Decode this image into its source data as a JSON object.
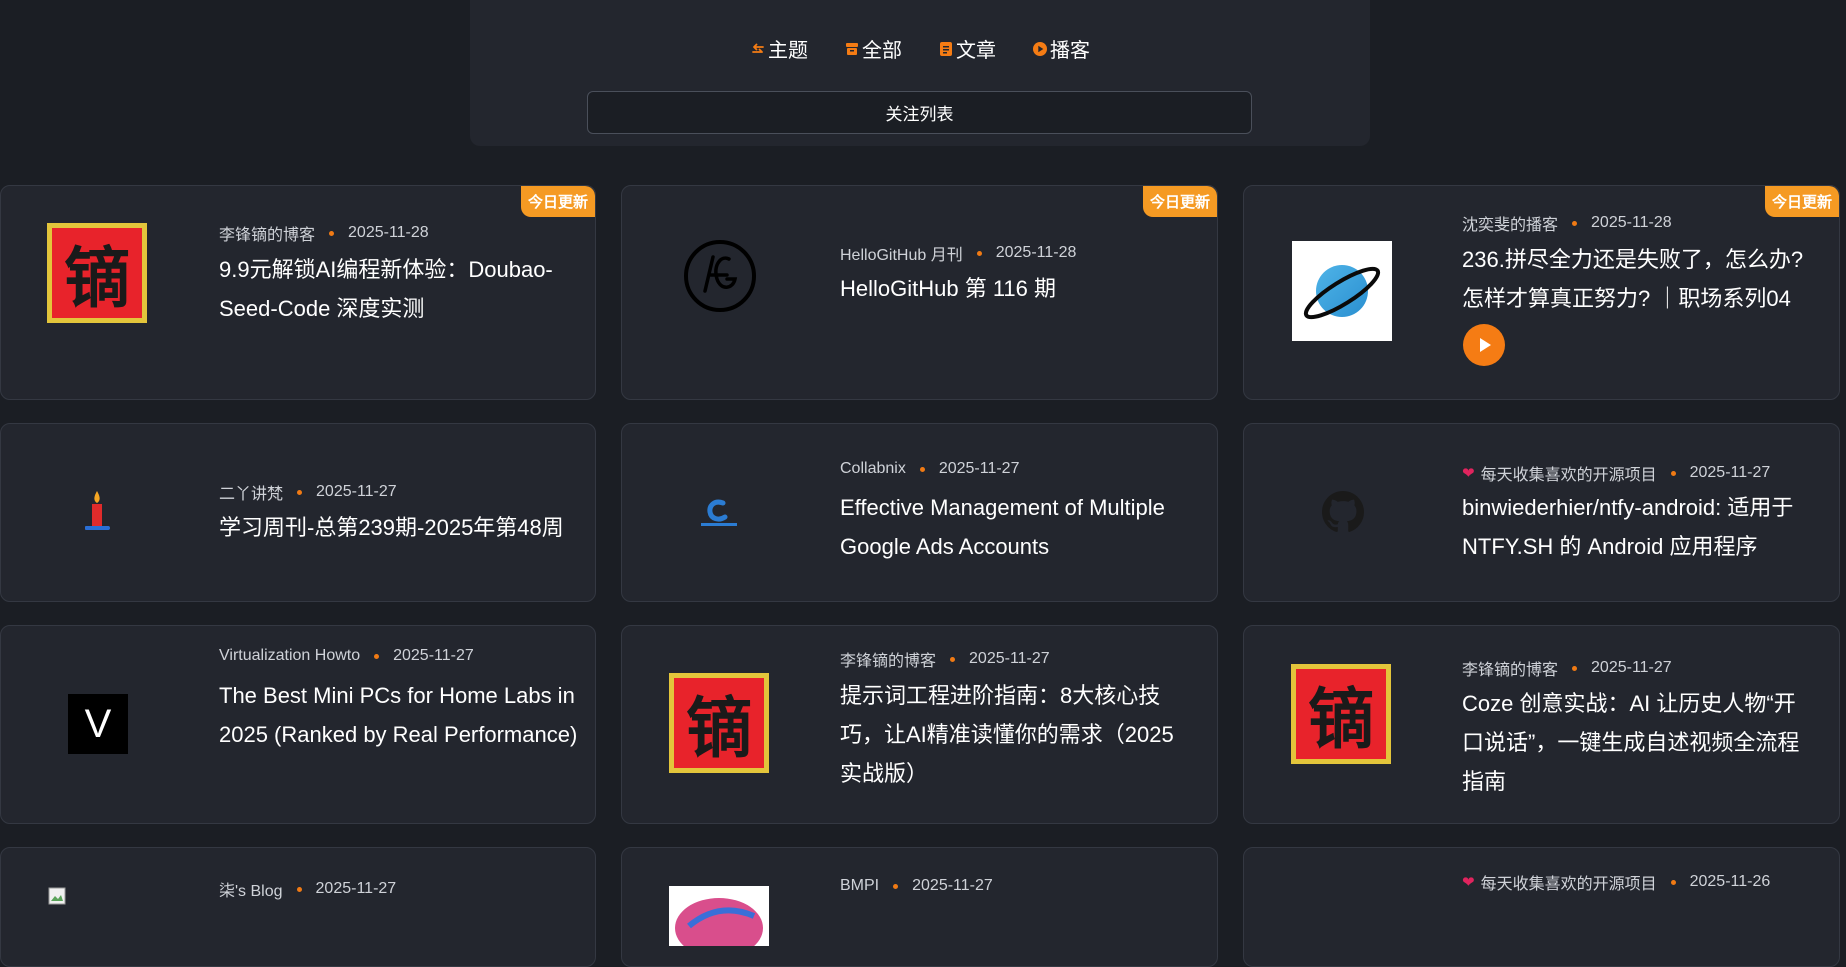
{
  "filters": [
    {
      "label": "主题",
      "icon": "swap-arrows-icon"
    },
    {
      "label": "全部",
      "icon": "archive-icon"
    },
    {
      "label": "文章",
      "icon": "document-icon"
    },
    {
      "label": "播客",
      "icon": "play-circle-icon"
    }
  ],
  "follow_button": "关注列表",
  "badge_label": "今日更新",
  "accent_color": "#f57c14",
  "zhai_char": "镝",
  "cards": [
    {
      "source": "李锋镝的博客",
      "date": "2025-11-28",
      "title": "9.9元解锁AI编程新体验：Doubao-Seed-Code 深度实测",
      "badge": true,
      "thumb": "zhai-logo"
    },
    {
      "source": "HelloGitHub 月刊",
      "date": "2025-11-28",
      "title": "HelloGitHub 第 116 期",
      "badge": true,
      "thumb": "hellogithub-logo"
    },
    {
      "source": "沈奕斐的播客",
      "date": "2025-11-28",
      "title": "236.拼尽全力还是失败了，怎么办?怎样才算真正努力? ｜职场系列04",
      "badge": true,
      "thumb": "planet-logo",
      "podcast": true
    },
    {
      "source": "二丫讲梵",
      "date": "2025-11-27",
      "title": "学习周刊-总第239期-2025年第48周",
      "thumb": "candle-logo"
    },
    {
      "source": "Collabnix",
      "date": "2025-11-27",
      "title": "Effective Management of Multiple Google Ads Accounts",
      "thumb": "collabnix-logo"
    },
    {
      "source": "每天收集喜欢的开源项目",
      "date": "2025-11-27",
      "title": "binwiederhier/ntfy-android: 适用于 NTFY.SH 的 Android 应用程序",
      "thumb": "github-logo",
      "heart": true
    },
    {
      "source": "Virtualization Howto",
      "date": "2025-11-27",
      "title": "The Best Mini PCs for Home Labs in 2025 (Ranked by Real Performance)",
      "thumb": "v-logo",
      "v_letter": "V"
    },
    {
      "source": "李锋镝的博客",
      "date": "2025-11-27",
      "title": "提示词工程进阶指南：8大核心技巧，让AI精准读懂你的需求（2025实战版）",
      "thumb": "zhai-logo"
    },
    {
      "source": "李锋镝的博客",
      "date": "2025-11-27",
      "title": "Coze 创意实战：AI 让历史人物“开口说话”，一键生成自述视频全流程指南",
      "thumb": "zhai-logo"
    },
    {
      "source": "柒's Blog",
      "date": "2025-11-27",
      "title": "",
      "thumb": "broken-image"
    },
    {
      "source": "BMPI",
      "date": "2025-11-27",
      "title": "",
      "thumb": "bmpi-logo"
    },
    {
      "source": "每天收集喜欢的开源项目",
      "date": "2025-11-26",
      "title": "",
      "thumb": "none",
      "heart": true
    }
  ]
}
